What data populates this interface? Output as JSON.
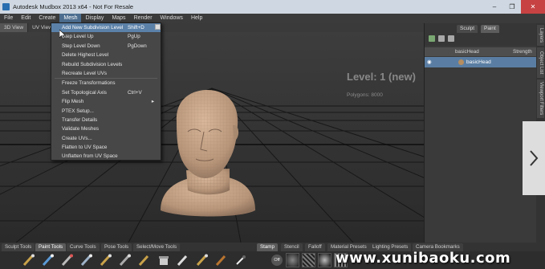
{
  "window": {
    "title": "Autodesk Mudbox 2013 x64 - Not For Resale",
    "controls": [
      "–",
      "❐",
      "✕"
    ]
  },
  "menubar": {
    "items": [
      "File",
      "Edit",
      "Create",
      "Mesh",
      "Display",
      "Maps",
      "Render",
      "Windows",
      "Help"
    ],
    "active": "Mesh"
  },
  "viewport_tabs": [
    "3D View",
    "UV View"
  ],
  "viewport": {
    "level_text": "Level: 1 (new)",
    "polygons_text": "Polygons: 8000"
  },
  "mesh_menu": {
    "items": [
      {
        "label": "Add New Subdivision Level",
        "shortcut": "Shift+D",
        "highlighted": true
      },
      {
        "label": "Step Level Up",
        "shortcut": "PgUp"
      },
      {
        "label": "Step Level Down",
        "shortcut": "PgDown"
      },
      {
        "label": "Delete Highest Level",
        "shortcut": ""
      },
      {
        "label": "Rebuild Subdivision Levels",
        "shortcut": ""
      },
      {
        "label": "Recreate Level UVs",
        "shortcut": ""
      },
      {
        "label": "Freeze Transformations",
        "shortcut": ""
      },
      {
        "label": "Set Topological Axis",
        "shortcut": "Ctrl+V"
      },
      {
        "label": "Flip Mesh",
        "shortcut": "",
        "submenu": "▸"
      },
      {
        "label": "PTEX Setup...",
        "shortcut": ""
      },
      {
        "label": "Transfer Details",
        "shortcut": ""
      },
      {
        "label": "Validate Meshes",
        "shortcut": ""
      },
      {
        "label": "Create UVs...",
        "shortcut": ""
      },
      {
        "label": "Flatten to UV Space",
        "shortcut": ""
      },
      {
        "label": "Unflatten from UV Space",
        "shortcut": ""
      }
    ]
  },
  "layers_panel": {
    "tabs": [
      "Sculpt",
      "Paint"
    ],
    "columns": [
      "basicHead",
      "Strength"
    ],
    "rows": [
      {
        "name": "basicHead"
      }
    ]
  },
  "side_tabs": [
    "Layers",
    "Object List",
    "Viewport Filters"
  ],
  "bottom_tabs_left": [
    "Sculpt Tools",
    "Paint Tools",
    "Curve Tools",
    "Pose Tools",
    "Select/Move Tools"
  ],
  "bottom_tabs_right": [
    "Stamp",
    "Stencil",
    "Falloff",
    "Material Presets",
    "Lighting Presets",
    "Camera Bookmarks"
  ],
  "active_left_tab": "Paint Tools",
  "active_right_tab": "Stamp",
  "stamp_off_label": "Off",
  "watermark": "www.xunibaoku.com",
  "colors": {
    "menu_highlight": "#5b81a8",
    "skin": "#c7a487",
    "title_bar": "#cfd8e2"
  }
}
